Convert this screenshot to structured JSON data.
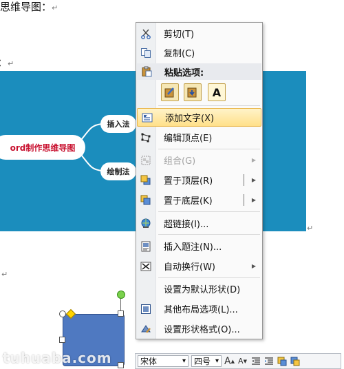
{
  "document": {
    "heading_text": "思维导图：",
    "label_text": "：",
    "para_mark": "↵"
  },
  "diagram": {
    "center_label": "ord制作思维导图",
    "branch_top": "插入法",
    "branch_bottom": "绘制法"
  },
  "watermark": "tuhuaba.com",
  "context_menu": {
    "items": [
      {
        "label": "剪切(T)",
        "icon": "scissors-icon"
      },
      {
        "label": "复制(C)",
        "icon": "copy-icon"
      },
      {
        "label": "粘贴选项:",
        "icon": "clipboard-icon"
      },
      {
        "label": "添加文字(X)",
        "icon": "add-text-icon"
      },
      {
        "label": "编辑顶点(E)",
        "icon": "edit-points-icon"
      },
      {
        "label": "组合(G)",
        "icon": "group-icon"
      },
      {
        "label": "置于顶层(R)",
        "icon": "bring-to-front-icon"
      },
      {
        "label": "置于底层(K)",
        "icon": "send-to-back-icon"
      },
      {
        "label": "超链接(I)...",
        "icon": "hyperlink-icon"
      },
      {
        "label": "插入题注(N)...",
        "icon": "caption-icon"
      },
      {
        "label": "自动换行(W)",
        "icon": "wrap-text-icon"
      },
      {
        "label": "设置为默认形状(D)",
        "icon": ""
      },
      {
        "label": "其他布局选项(L)...",
        "icon": "layout-options-icon"
      },
      {
        "label": "设置形状格式(O)...",
        "icon": "format-shape-icon"
      }
    ],
    "paste_options": [
      "paste-format-icon",
      "paste-merge-icon",
      "paste-text-only-icon"
    ],
    "paste_text_glyph": "A",
    "submenu_glyph": "▶"
  },
  "mini_toolbar": {
    "font_name": "宋体",
    "font_size": "四号",
    "dropdown_glyph": "▾",
    "grow_font": "A",
    "shrink_font": "A"
  },
  "colors": {
    "diagram_band": "#1b8dbd",
    "shape_fill": "#4f79c1",
    "menu_highlight": "#ffe08a"
  }
}
